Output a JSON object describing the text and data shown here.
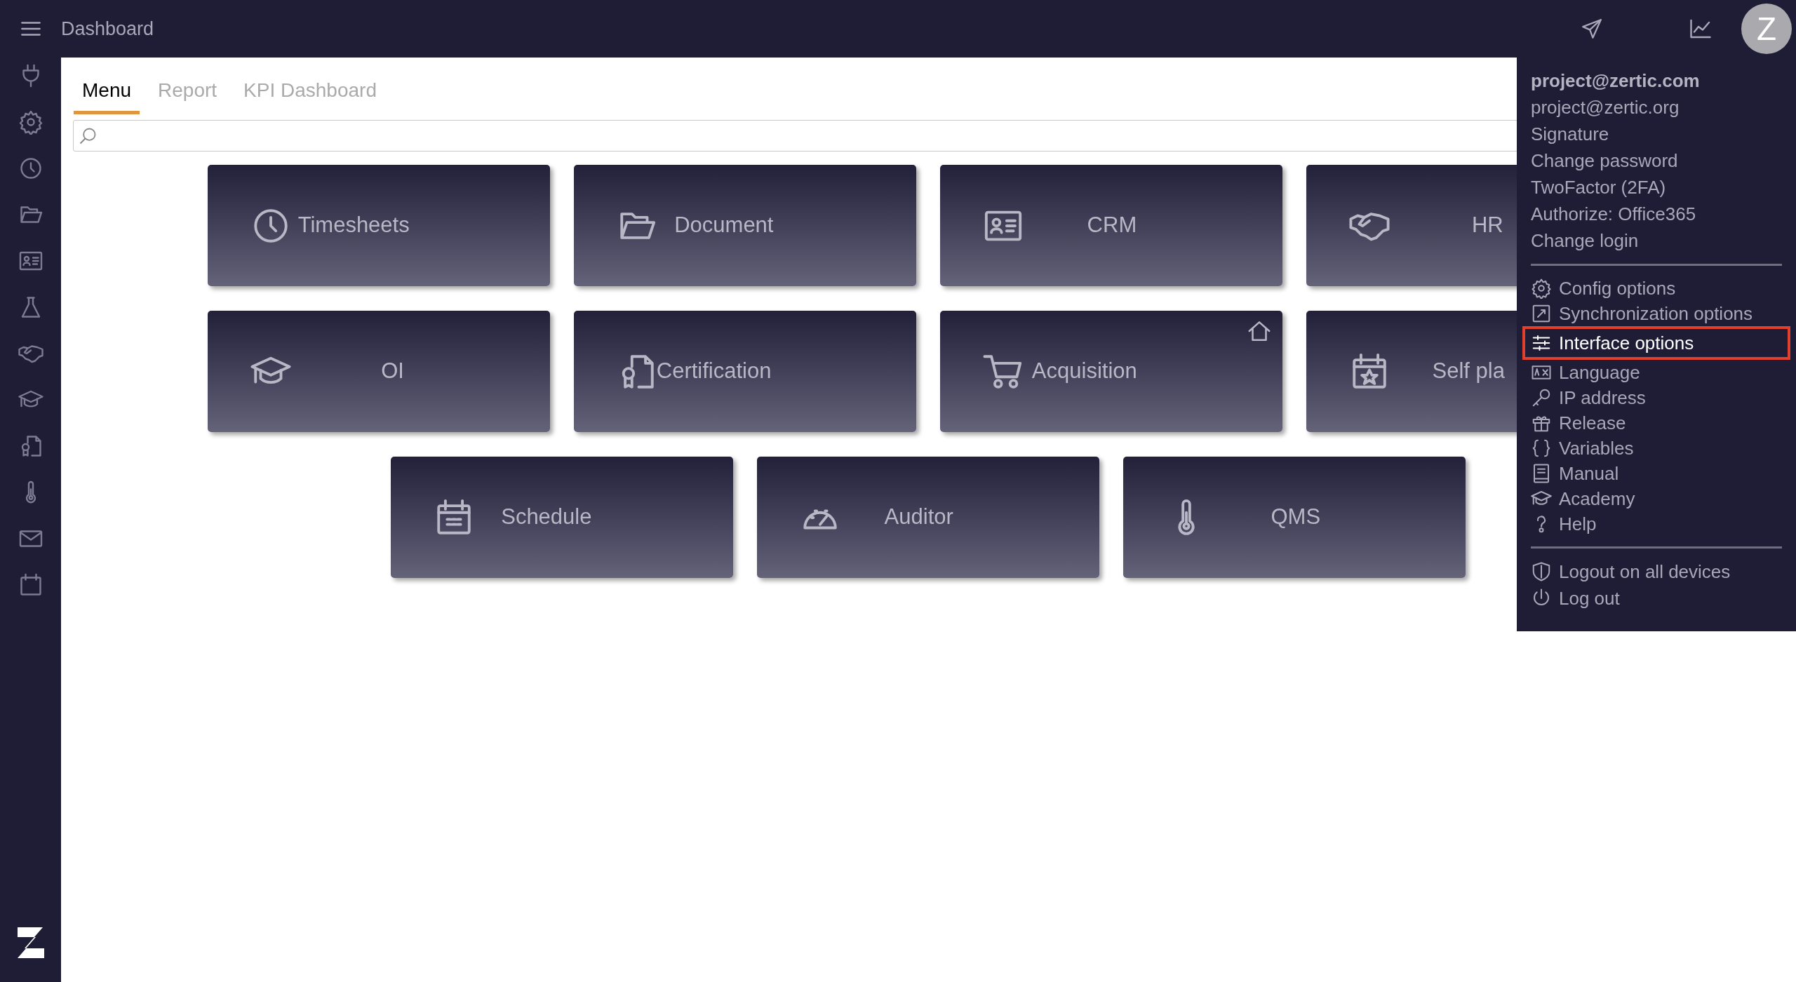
{
  "topbar": {
    "title": "Dashboard",
    "avatar": "Z"
  },
  "tabs": [
    {
      "label": "Menu",
      "selected": true
    },
    {
      "label": "Report",
      "selected": false
    },
    {
      "label": "KPI Dashboard",
      "selected": false
    }
  ],
  "tiles": [
    [
      {
        "label": "Timesheets",
        "home": false
      },
      {
        "label": "Document",
        "home": false
      },
      {
        "label": "CRM",
        "home": false
      },
      {
        "label": "HR",
        "home": false
      }
    ],
    [
      {
        "label": "OI",
        "home": false
      },
      {
        "label": "Certification",
        "home": false
      },
      {
        "label": "Acquisition",
        "home": true
      },
      {
        "label": "Self pla",
        "home": false
      }
    ],
    [
      {
        "label": "Schedule",
        "home": false
      },
      {
        "label": "Auditor",
        "home": false
      },
      {
        "label": "QMS",
        "home": false
      }
    ]
  ],
  "user_menu": {
    "account": [
      {
        "label": "project@zertic.com",
        "current": true
      },
      {
        "label": "project@zertic.org",
        "current": false
      },
      {
        "label": "Signature",
        "current": false
      },
      {
        "label": "Change password",
        "current": false
      },
      {
        "label": "TwoFactor (2FA)",
        "current": false
      },
      {
        "label": "Authorize: Office365",
        "current": false
      },
      {
        "label": "Change login",
        "current": false
      }
    ],
    "options": [
      {
        "label": "Config options",
        "selected": false
      },
      {
        "label": "Synchronization options",
        "selected": false
      },
      {
        "label": "Interface options",
        "selected": true
      },
      {
        "label": "Language",
        "selected": false
      },
      {
        "label": "IP address",
        "selected": false
      },
      {
        "label": "Release",
        "selected": false
      },
      {
        "label": "Variables",
        "selected": false
      },
      {
        "label": "Manual",
        "selected": false
      },
      {
        "label": "Academy",
        "selected": false
      },
      {
        "label": "Help",
        "selected": false
      }
    ],
    "session": [
      {
        "label": "Logout on all devices"
      },
      {
        "label": "Log out"
      }
    ]
  }
}
